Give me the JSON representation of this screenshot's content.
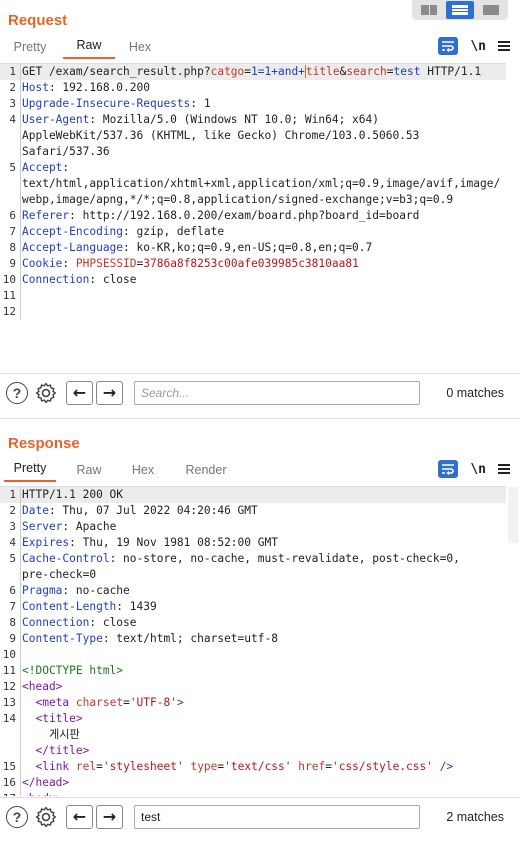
{
  "view_toggle": {
    "icons": [
      "split-vertical-icon",
      "split-horizontal-icon",
      "single-pane-icon"
    ],
    "active": "split-horizontal-icon"
  },
  "request": {
    "title": "Request",
    "tabs": [
      "Pretty",
      "Raw",
      "Hex"
    ],
    "active_tab": "Raw",
    "tools": {
      "newline_label": "\\n"
    },
    "lines": [
      {
        "n": "1",
        "parts": [
          [
            "hv",
            "GET /exam/search_result.php?"
          ],
          [
            "pn",
            "catgo"
          ],
          [
            "hv",
            "="
          ],
          [
            "pv",
            "1=1+and+"
          ],
          [
            "cursor",
            ""
          ],
          [
            "pn",
            "title"
          ],
          [
            "hv",
            "&"
          ],
          [
            "pn",
            "search"
          ],
          [
            "hv",
            "="
          ],
          [
            "pv",
            "test"
          ],
          [
            "hv",
            " HTTP/1.1"
          ]
        ]
      },
      {
        "n": "2",
        "parts": [
          [
            "hk",
            "Host"
          ],
          [
            "hv",
            ": 192.168.0.200"
          ]
        ]
      },
      {
        "n": "3",
        "parts": [
          [
            "hk",
            "Upgrade-Insecure-Requests"
          ],
          [
            "hv",
            ": 1"
          ]
        ]
      },
      {
        "n": "4",
        "parts": [
          [
            "hk",
            "User-Agent"
          ],
          [
            "hv",
            ": Mozilla/5.0 (Windows NT 10.0; Win64; x64)\nAppleWebKit/537.36 (KHTML, like Gecko) Chrome/103.0.5060.53\nSafari/537.36"
          ]
        ]
      },
      {
        "n": "5",
        "parts": [
          [
            "hk",
            "Accept"
          ],
          [
            "hv",
            ":\ntext/html,application/xhtml+xml,application/xml;q=0.9,image/avif,image/webp,image/apng,*/*;q=0.8,application/signed-exchange;v=b3;q=0.9"
          ]
        ]
      },
      {
        "n": "6",
        "parts": [
          [
            "hk",
            "Referer"
          ],
          [
            "hv",
            ": http://192.168.0.200/exam/board.php?board_id=board"
          ]
        ]
      },
      {
        "n": "7",
        "parts": [
          [
            "hk",
            "Accept-Encoding"
          ],
          [
            "hv",
            ": gzip, deflate"
          ]
        ]
      },
      {
        "n": "8",
        "parts": [
          [
            "hk",
            "Accept-Language"
          ],
          [
            "hv",
            ": ko-KR,ko;q=0.9,en-US;q=0.8,en;q=0.7"
          ]
        ]
      },
      {
        "n": "9",
        "parts": [
          [
            "hk",
            "Cookie"
          ],
          [
            "hv",
            ": "
          ],
          [
            "pn",
            "PHPSESSID"
          ],
          [
            "hv",
            "="
          ],
          [
            "ck",
            "3786a8f8253c00afe039985c3810aa81"
          ]
        ]
      },
      {
        "n": "10",
        "parts": [
          [
            "hk",
            "Connection"
          ],
          [
            "hv",
            ": close"
          ]
        ]
      },
      {
        "n": "11",
        "parts": [
          [
            "hv",
            ""
          ]
        ]
      },
      {
        "n": "12",
        "parts": [
          [
            "hv",
            ""
          ]
        ]
      }
    ],
    "search": {
      "placeholder": "Search...",
      "value": "",
      "matches": "0 matches"
    }
  },
  "response": {
    "title": "Response",
    "tabs": [
      "Pretty",
      "Raw",
      "Hex",
      "Render"
    ],
    "active_tab": "Pretty",
    "tools": {
      "newline_label": "\\n"
    },
    "lines": [
      {
        "n": "1",
        "parts": [
          [
            "hv",
            "HTTP/1.1 200 OK"
          ]
        ]
      },
      {
        "n": "2",
        "parts": [
          [
            "hk",
            "Date"
          ],
          [
            "hv",
            ": Thu, 07 Jul 2022 04:20:46 GMT"
          ]
        ]
      },
      {
        "n": "3",
        "parts": [
          [
            "hk",
            "Server"
          ],
          [
            "hv",
            ": Apache"
          ]
        ]
      },
      {
        "n": "4",
        "parts": [
          [
            "hk",
            "Expires"
          ],
          [
            "hv",
            ": Thu, 19 Nov 1981 08:52:00 GMT"
          ]
        ]
      },
      {
        "n": "5",
        "parts": [
          [
            "hk",
            "Cache-Control"
          ],
          [
            "hv",
            ": no-store, no-cache, must-revalidate, post-check=0,\npre-check=0"
          ]
        ]
      },
      {
        "n": "6",
        "parts": [
          [
            "hk",
            "Pragma"
          ],
          [
            "hv",
            ": no-cache"
          ]
        ]
      },
      {
        "n": "7",
        "parts": [
          [
            "hk",
            "Content-Length"
          ],
          [
            "hv",
            ": 1439"
          ]
        ]
      },
      {
        "n": "8",
        "parts": [
          [
            "hk",
            "Connection"
          ],
          [
            "hv",
            ": close"
          ]
        ]
      },
      {
        "n": "9",
        "parts": [
          [
            "hk",
            "Content-Type"
          ],
          [
            "hv",
            ": text/html; charset=utf-8"
          ]
        ]
      },
      {
        "n": "10",
        "parts": [
          [
            "hv",
            ""
          ]
        ]
      },
      {
        "n": "11",
        "parts": [
          [
            "tg",
            "<!DOCTYPE html>"
          ]
        ]
      },
      {
        "n": "12",
        "parts": [
          [
            "tn",
            "<head>"
          ]
        ]
      },
      {
        "n": "13",
        "parts": [
          [
            "hv",
            "  "
          ],
          [
            "tn",
            "<meta "
          ],
          [
            "pn",
            "charset"
          ],
          [
            "hv",
            "="
          ],
          [
            "av",
            "'UTF-8'"
          ],
          [
            "tn",
            ">"
          ]
        ]
      },
      {
        "n": "14",
        "parts": [
          [
            "hv",
            "  "
          ],
          [
            "tn",
            "<title>"
          ],
          [
            "hv",
            "\n    게시판\n  "
          ],
          [
            "tn",
            "</title>"
          ]
        ]
      },
      {
        "n": "15",
        "parts": [
          [
            "hv",
            "  "
          ],
          [
            "tn",
            "<link "
          ],
          [
            "pn",
            "rel"
          ],
          [
            "hv",
            "="
          ],
          [
            "av",
            "'stylesheet'"
          ],
          [
            "hv",
            " "
          ],
          [
            "pn",
            "type"
          ],
          [
            "hv",
            "="
          ],
          [
            "av",
            "'text/css'"
          ],
          [
            "hv",
            " "
          ],
          [
            "pn",
            "href"
          ],
          [
            "hv",
            "="
          ],
          [
            "av",
            "'css/style.css'"
          ],
          [
            "tn",
            " />"
          ]
        ]
      },
      {
        "n": "16",
        "parts": [
          [
            "tn",
            "</head>"
          ]
        ]
      },
      {
        "n": "17",
        "parts": [
          [
            "tn",
            "<body>"
          ]
        ]
      }
    ],
    "search": {
      "placeholder": "Search...",
      "value": "test",
      "matches": "2 matches"
    }
  }
}
